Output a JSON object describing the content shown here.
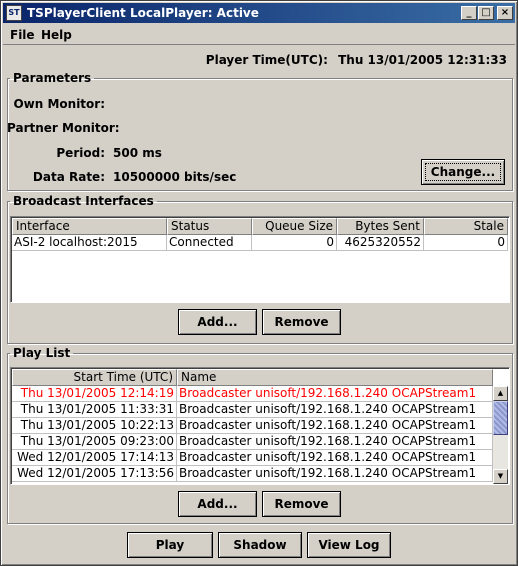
{
  "window": {
    "title": "TSPlayerClient LocalPlayer: Active",
    "icon_text": "ST",
    "controls": {
      "minimize": "_",
      "maximize": "□",
      "close": "×"
    }
  },
  "menu": {
    "file": "File",
    "help": "Help"
  },
  "player_time": {
    "label": "Player Time(UTC):",
    "value": "Thu 13/01/2005 12:31:33"
  },
  "parameters": {
    "legend": "Parameters",
    "own_monitor_label": "Own Monitor:",
    "own_monitor_value": "",
    "partner_monitor_label": "Partner Monitor:",
    "partner_monitor_value": "",
    "period_label": "Period:",
    "period_value": "500 ms",
    "data_rate_label": "Data Rate:",
    "data_rate_value": "10500000 bits/sec",
    "change_button": "Change..."
  },
  "broadcast": {
    "legend": "Broadcast Interfaces",
    "columns": [
      "Interface",
      "Status",
      "Queue Size",
      "Bytes Sent",
      "Stale"
    ],
    "rows": [
      [
        "ASI-2 localhost:2015",
        "Connected",
        "0",
        "4625320552",
        "0"
      ]
    ],
    "add_button": "Add...",
    "remove_button": "Remove"
  },
  "playlist": {
    "legend": "Play List",
    "columns": [
      "Start Time (UTC)",
      "Name"
    ],
    "rows": [
      [
        "Thu 13/01/2005 12:14:19",
        "Broadcaster unisoft/192.168.1.240 OCAPStream1"
      ],
      [
        "Thu 13/01/2005 11:33:31",
        "Broadcaster unisoft/192.168.1.240 OCAPStream1"
      ],
      [
        "Thu 13/01/2005 10:22:13",
        "Broadcaster unisoft/192.168.1.240 OCAPStream1"
      ],
      [
        "Thu 13/01/2005 09:23:00",
        "Broadcaster unisoft/192.168.1.240 OCAPStream1"
      ],
      [
        "Wed 12/01/2005 17:14:13",
        "Broadcaster unisoft/192.168.1.240 OCAPStream1"
      ],
      [
        "Wed 12/01/2005 17:13:56",
        "Broadcaster unisoft/192.168.1.240 OCAPStream1"
      ]
    ],
    "active_row_color": "#ff0000",
    "add_button": "Add...",
    "remove_button": "Remove"
  },
  "actions": {
    "play": "Play",
    "shadow": "Shadow",
    "view_log": "View Log"
  },
  "icons": {
    "scroll_up": "scroll-up-arrow-icon",
    "scroll_down": "scroll-down-arrow-icon"
  }
}
